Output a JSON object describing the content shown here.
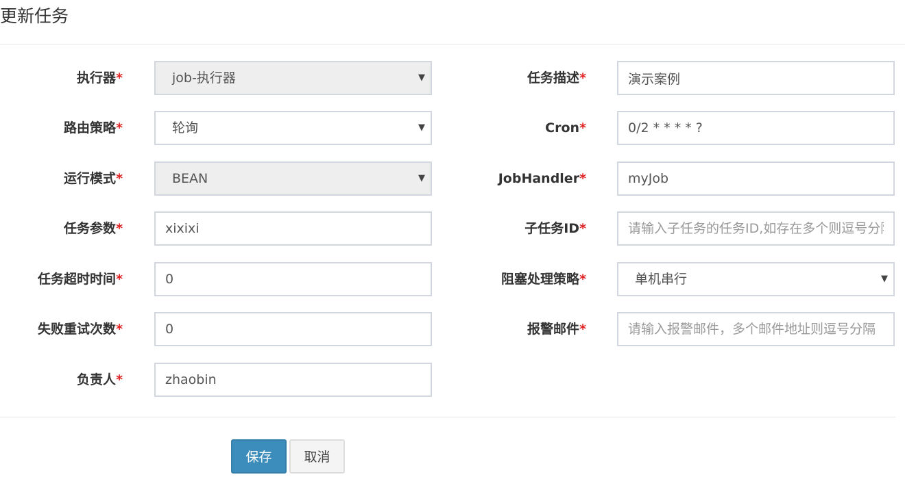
{
  "page": {
    "title": "更新任务"
  },
  "form": {
    "left": [
      {
        "label": "执行器",
        "required": "*",
        "value": "job-执行器",
        "kind": "select",
        "disabled": true
      },
      {
        "label": "路由策略",
        "required": "*",
        "value": "轮询",
        "kind": "select",
        "disabled": false
      },
      {
        "label": "运行模式",
        "required": "*",
        "value": "BEAN",
        "kind": "select",
        "disabled": true
      },
      {
        "label": "任务参数",
        "required": "*",
        "value": "xixixi",
        "kind": "input"
      },
      {
        "label": "任务超时时间",
        "required": "*",
        "value": "0",
        "kind": "input"
      },
      {
        "label": "失败重试次数",
        "required": "*",
        "value": "0",
        "kind": "input"
      },
      {
        "label": "负责人",
        "required": "*",
        "value": "zhaobin",
        "kind": "input"
      }
    ],
    "right": [
      {
        "label": "任务描述",
        "required": "*",
        "value": "演示案例",
        "kind": "input"
      },
      {
        "label": "Cron",
        "required": "*",
        "value": "0/2 * * * * ?",
        "kind": "input"
      },
      {
        "label": "JobHandler",
        "required": "*",
        "value": "myJob",
        "kind": "input"
      },
      {
        "label": "子任务ID",
        "required": "*",
        "value": "",
        "placeholder": "请输入子任务的任务ID,如存在多个则逗号分隔",
        "kind": "input"
      },
      {
        "label": "阻塞处理策略",
        "required": "*",
        "value": "单机串行",
        "kind": "select",
        "disabled": false
      },
      {
        "label": "报警邮件",
        "required": "*",
        "value": "",
        "placeholder": "请输入报警邮件，多个邮件地址则逗号分隔",
        "kind": "input"
      }
    ]
  },
  "buttons": {
    "save": "保存",
    "cancel": "取消"
  },
  "icons": {
    "select_caret": "caret-down-icon",
    "caret_glyph": "▼"
  },
  "colors": {
    "primary": "#3c8dbc",
    "required": "#e02020",
    "disabled_bg": "#eeeeee",
    "border": "#d2d6de"
  }
}
